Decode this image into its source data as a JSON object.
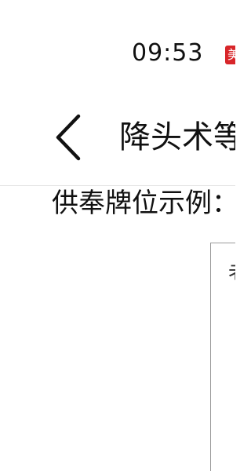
{
  "status_bar": {
    "time": "09:53",
    "badge": "美"
  },
  "nav": {
    "title": "降头术等"
  },
  "content": {
    "section_label": "供奉牌位示例：",
    "plaque_text": "老"
  },
  "colors": {
    "badge_bg": "#d8262a",
    "text": "#111111",
    "frame_border": "#9a9a9a"
  }
}
